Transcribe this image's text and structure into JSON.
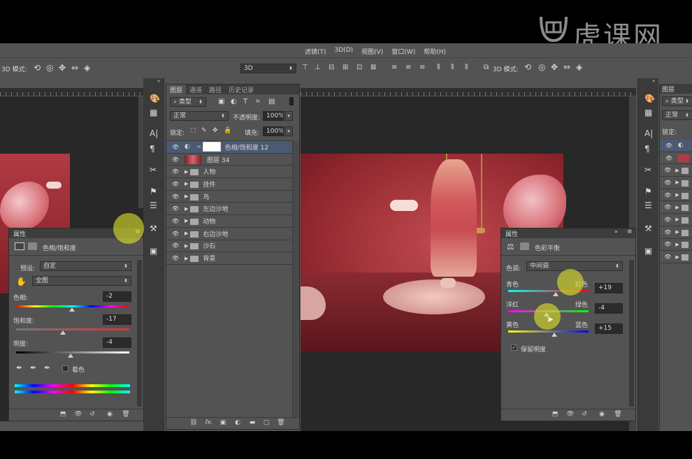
{
  "watermark": {
    "text": "虎课网",
    "logo": "huke-logo"
  },
  "window_controls": {
    "minimize": "▬",
    "maximize": "□",
    "close": "✕"
  },
  "menubar": {
    "items": [
      "滤镜(T)",
      "3D(D)",
      "视图(V)",
      "窗口(W)",
      "帮助(H)"
    ]
  },
  "options_left": {
    "mode_label": "3D 模式:"
  },
  "options_right": {
    "mode_label": "3D 模式:",
    "dropdown_value": "3D"
  },
  "layers_panel": {
    "tabs": [
      "图层",
      "通道",
      "路径",
      "历史记录"
    ],
    "filter_label": "类型",
    "blend_mode": "正常",
    "opacity_label": "不透明度:",
    "opacity_value": "100%",
    "lock_label": "锁定:",
    "fill_label": "填充:",
    "fill_value": "100%",
    "layers": [
      {
        "name": "色相/饱和度 12",
        "type": "adjustment",
        "selected": true
      },
      {
        "name": "图层 34",
        "type": "image"
      },
      {
        "name": "人物",
        "type": "group"
      },
      {
        "name": "挂件",
        "type": "group"
      },
      {
        "name": "鸟",
        "type": "group"
      },
      {
        "name": "左边沙地",
        "type": "group"
      },
      {
        "name": "动物",
        "type": "group"
      },
      {
        "name": "右边沙地",
        "type": "group"
      },
      {
        "name": "沙石",
        "type": "group"
      },
      {
        "name": "背景",
        "type": "group"
      }
    ],
    "footer_icons": [
      "link-icon",
      "fx-icon",
      "mask-icon",
      "adjustment-icon",
      "folder-icon",
      "new-layer-icon",
      "trash-icon"
    ],
    "footer_fx": "fx."
  },
  "props_left": {
    "header": "属性",
    "title": "色相/饱和度",
    "preset_label": "预设:",
    "preset_value": "自定",
    "channel_value": "全图",
    "hue_label": "色相:",
    "hue_value": "-2",
    "hue_level": -2,
    "sat_label": "饱和度:",
    "sat_value": "-17",
    "sat_level": -17,
    "light_label": "明度:",
    "light_value": "-4",
    "light_level": -4,
    "colorize_label": "着色"
  },
  "props_right": {
    "header": "属性",
    "title": "色彩平衡",
    "tone_label": "色调:",
    "tone_value": "中间调",
    "rows": [
      {
        "left": "青色",
        "right": "红色",
        "value": "+19",
        "level": 19
      },
      {
        "left": "洋红",
        "right": "绿色",
        "value": "-4",
        "level": -4
      },
      {
        "left": "黄色",
        "right": "蓝色",
        "value": "+15",
        "level": 15
      }
    ],
    "preserve_label": "保留明度"
  },
  "right_edge": {
    "tab": "图层",
    "filter": "类型",
    "blend": "正常",
    "lock": "锁定:"
  },
  "colors": {
    "accent_highlight": "#e1e628",
    "panel": "#535353",
    "dark": "#282828",
    "canvas_red": "#a8353c",
    "selected_layer": "#4b5a72"
  }
}
